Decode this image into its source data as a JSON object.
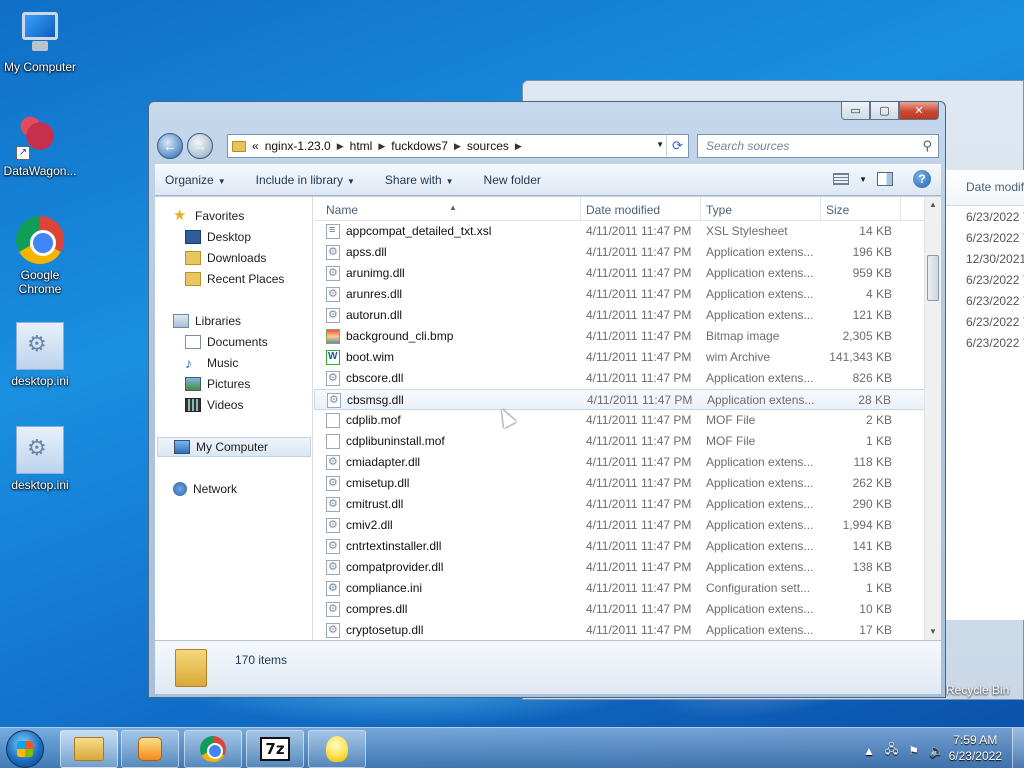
{
  "desktop": {
    "icons": [
      {
        "label": "My Computer",
        "icon": "computer-icon"
      },
      {
        "label": "DataWagon...",
        "icon": "datawagon-icon"
      },
      {
        "label": "Google Chrome",
        "icon": "chrome-icon"
      },
      {
        "label": "desktop.ini",
        "icon": "ini-file-icon"
      },
      {
        "label": "desktop.ini",
        "icon": "ini-file-icon"
      }
    ],
    "recycle_bin_label": "Recycle Bin"
  },
  "background_window": {
    "column_header": "Date modif",
    "dates": [
      "6/23/2022 7",
      "6/23/2022 7",
      "12/30/2021",
      "6/23/2022 7",
      "6/23/2022 7",
      "6/23/2022 7",
      "6/23/2022 7"
    ]
  },
  "window": {
    "caption": {
      "minimize": "▭",
      "maximize": "▢",
      "close": "✕"
    },
    "address": {
      "overflow": "«",
      "crumbs": [
        "nginx-1.23.0",
        "html",
        "fuckdows7",
        "sources"
      ]
    },
    "search": {
      "placeholder": "Search sources"
    },
    "toolbar": {
      "organize": "Organize",
      "include_in_library": "Include in library",
      "share_with": "Share with",
      "new_folder": "New folder"
    },
    "nav_pane": {
      "favorites": "Favorites",
      "desktop": "Desktop",
      "downloads": "Downloads",
      "recent_places": "Recent Places",
      "libraries": "Libraries",
      "documents": "Documents",
      "music": "Music",
      "pictures": "Pictures",
      "videos": "Videos",
      "my_computer": "My Computer",
      "network": "Network"
    },
    "columns": {
      "name": "Name",
      "date": "Date modified",
      "type": "Type",
      "size": "Size"
    },
    "files": [
      {
        "name": "appcompat_detailed_txt.xsl",
        "date": "4/11/2011 11:47 PM",
        "type": "XSL Stylesheet",
        "size": "14 KB",
        "icon": "xsl"
      },
      {
        "name": "apss.dll",
        "date": "4/11/2011 11:47 PM",
        "type": "Application extens...",
        "size": "196 KB",
        "icon": "dll"
      },
      {
        "name": "arunimg.dll",
        "date": "4/11/2011 11:47 PM",
        "type": "Application extens...",
        "size": "959 KB",
        "icon": "dll"
      },
      {
        "name": "arunres.dll",
        "date": "4/11/2011 11:47 PM",
        "type": "Application extens...",
        "size": "4 KB",
        "icon": "dll"
      },
      {
        "name": "autorun.dll",
        "date": "4/11/2011 11:47 PM",
        "type": "Application extens...",
        "size": "121 KB",
        "icon": "dll"
      },
      {
        "name": "background_cli.bmp",
        "date": "4/11/2011 11:47 PM",
        "type": "Bitmap image",
        "size": "2,305 KB",
        "icon": "bmp"
      },
      {
        "name": "boot.wim",
        "date": "4/11/2011 11:47 PM",
        "type": "wim Archive",
        "size": "141,343 KB",
        "icon": "wim"
      },
      {
        "name": "cbscore.dll",
        "date": "4/11/2011 11:47 PM",
        "type": "Application extens...",
        "size": "826 KB",
        "icon": "dll"
      },
      {
        "name": "cbsmsg.dll",
        "date": "4/11/2011 11:47 PM",
        "type": "Application extens...",
        "size": "28 KB",
        "icon": "dll"
      },
      {
        "name": "cdplib.mof",
        "date": "4/11/2011 11:47 PM",
        "type": "MOF File",
        "size": "2 KB",
        "icon": "file"
      },
      {
        "name": "cdplibuninstall.mof",
        "date": "4/11/2011 11:47 PM",
        "type": "MOF File",
        "size": "1 KB",
        "icon": "file"
      },
      {
        "name": "cmiadapter.dll",
        "date": "4/11/2011 11:47 PM",
        "type": "Application extens...",
        "size": "118 KB",
        "icon": "dll"
      },
      {
        "name": "cmisetup.dll",
        "date": "4/11/2011 11:47 PM",
        "type": "Application extens...",
        "size": "262 KB",
        "icon": "dll"
      },
      {
        "name": "cmitrust.dll",
        "date": "4/11/2011 11:47 PM",
        "type": "Application extens...",
        "size": "290 KB",
        "icon": "dll"
      },
      {
        "name": "cmiv2.dll",
        "date": "4/11/2011 11:47 PM",
        "type": "Application extens...",
        "size": "1,994 KB",
        "icon": "dll"
      },
      {
        "name": "cntrtextinstaller.dll",
        "date": "4/11/2011 11:47 PM",
        "type": "Application extens...",
        "size": "141 KB",
        "icon": "dll"
      },
      {
        "name": "compatprovider.dll",
        "date": "4/11/2011 11:47 PM",
        "type": "Application extens...",
        "size": "138 KB",
        "icon": "dll"
      },
      {
        "name": "compliance.ini",
        "date": "4/11/2011 11:47 PM",
        "type": "Configuration sett...",
        "size": "1 KB",
        "icon": "ini"
      },
      {
        "name": "compres.dll",
        "date": "4/11/2011 11:47 PM",
        "type": "Application extens...",
        "size": "10 KB",
        "icon": "dll"
      },
      {
        "name": "cryptosetup.dll",
        "date": "4/11/2011 11:47 PM",
        "type": "Application extens...",
        "size": "17 KB",
        "icon": "dll"
      }
    ],
    "hovered_index": 8,
    "item_count": "170 items"
  },
  "taskbar": {
    "seven_zip": "7z",
    "clock_time": "7:59 AM",
    "clock_date": "6/23/2022"
  }
}
